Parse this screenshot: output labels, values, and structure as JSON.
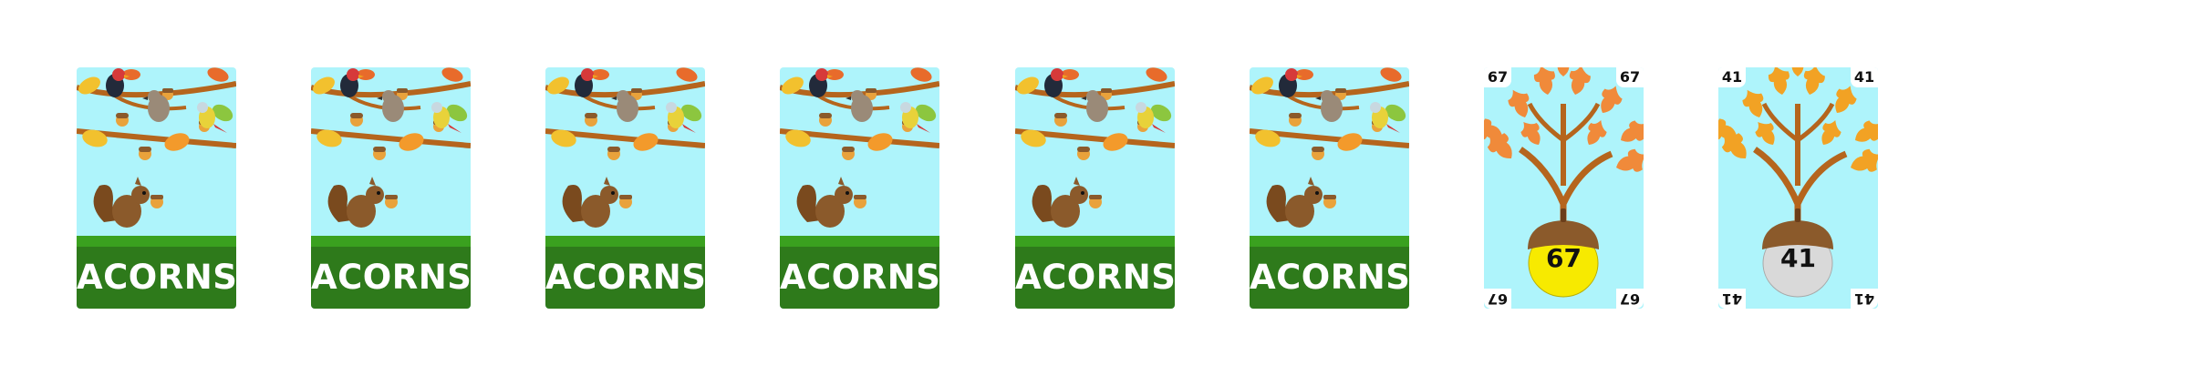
{
  "hand": {
    "back_cards": [
      {
        "label": "ACORNS"
      },
      {
        "label": "ACORNS"
      },
      {
        "label": "ACORNS"
      },
      {
        "label": "ACORNS"
      },
      {
        "label": "ACORNS"
      },
      {
        "label": "ACORNS"
      }
    ],
    "face_cards": [
      {
        "value": "67",
        "acorn_color": "#f7ea00",
        "leaf_color": "#f08a3a"
      },
      {
        "value": "41",
        "acorn_color": "#d9d9d9",
        "leaf_color": "#f2a224"
      }
    ]
  },
  "colors": {
    "sky": "#aef4fb",
    "ground": "#3aa11f",
    "title_band": "#2e7a1b",
    "branch": "#b5651d"
  }
}
